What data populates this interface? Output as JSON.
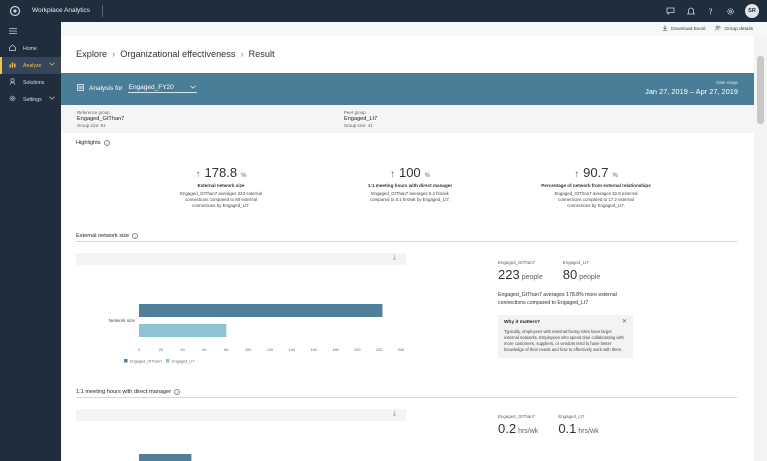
{
  "app": {
    "title": "Workplace Analytics",
    "avatar_initials": "SR",
    "top_icons": [
      "feedback-icon",
      "notifications-icon",
      "help-icon",
      "settings-icon"
    ]
  },
  "nav": {
    "items": [
      {
        "label": "Home",
        "icon": "home-icon"
      },
      {
        "label": "Analyze",
        "icon": "analyze-icon",
        "active": true
      },
      {
        "label": "Solutions",
        "icon": "solutions-icon"
      },
      {
        "label": "Settings",
        "icon": "settings-icon"
      }
    ]
  },
  "commands": {
    "download": "Download Excel",
    "group_details": "Group details"
  },
  "breadcrumb": [
    "Explore",
    "Organizational effectiveness",
    "Result"
  ],
  "analysis": {
    "label": "Analysis for",
    "selected": "Engaged_FY20",
    "date_range_label": "Date range",
    "date_range": "Jan 27, 2019 – Apr 27, 2019"
  },
  "reference_group": {
    "label": "Reference group",
    "name": "Engaged_GtThan7",
    "size": "Group size: 51"
  },
  "peer_group": {
    "label": "Peer group",
    "name": "Engaged_Lt7",
    "size": "Group size: 41"
  },
  "highlights": {
    "title": "Highlights",
    "cards": [
      {
        "value": "178.8",
        "unit": "%",
        "metric": "External network size",
        "desc": "Engaged_GtThan7 averages 223 external connections compared to 80 external connections by Engaged_Lt7."
      },
      {
        "value": "100",
        "unit": "%",
        "metric": "1:1 meeting hours with direct manager",
        "desc": "Engaged_GtThan7 averages 0.2 hrs/wk compared to 0.1 hrs/wk by Engaged_Lt7."
      },
      {
        "value": "90.7",
        "unit": "%",
        "metric": "Percentage of network from external relationships",
        "desc": "Engaged_GtThan7 averages 32.8 external connections compared to 17.2 external connections by Engaged_Lt7."
      }
    ]
  },
  "sections": {
    "external": {
      "title": "External network size",
      "ref_label": "Engaged_GtThan7",
      "ref_value": "223",
      "ref_unit": "people",
      "peer_label": "Engaged_Lt7",
      "peer_value": "80",
      "peer_unit": "people",
      "statement": "Engaged_GtThan7 averages 178.8% more external connections compared to Engaged_Lt7",
      "why_title": "Why it matters?",
      "why_body": "Typically, employees with external-facing roles have larger external networks. Employees who spend time collaborating with more customers, suppliers, or vendors tend to have better knowledge of their needs and how to effectively work with them."
    },
    "meeting": {
      "title": "1:1 meeting hours with direct manager",
      "ref_label": "Engaged_GtThan7",
      "ref_value": "0.2",
      "ref_unit": "hrs/wk",
      "peer_label": "Engaged_Lt7",
      "peer_value": "0.1",
      "peer_unit": "hrs/wk"
    }
  },
  "colors": {
    "nav_bg": "#1f2d3d",
    "band_bg": "#4a7d97",
    "series_ref": "#4f7f99",
    "series_peer": "#8ec3d6",
    "nav_active": "#f3c34b"
  },
  "chart_data": [
    {
      "type": "bar",
      "orientation": "horizontal",
      "categories": [
        "Network size"
      ],
      "series": [
        {
          "name": "Engaged_GtThan7",
          "values": [
            223
          ],
          "color": "#4f7f99"
        },
        {
          "name": "Engaged_Lt7",
          "values": [
            80
          ],
          "color": "#8ec3d6"
        }
      ],
      "x_ticks": [
        "0",
        "20",
        "40",
        "60",
        "80",
        "100",
        "120",
        "140",
        "160",
        "180",
        "200",
        "220",
        "240"
      ],
      "xlim": [
        0,
        240
      ],
      "grid": false,
      "legend": "bottom-left"
    },
    {
      "type": "bar",
      "orientation": "horizontal",
      "categories": [
        ""
      ],
      "series": [
        {
          "name": "Engaged_GtThan7",
          "values": [
            0.2
          ],
          "color": "#4f7f99"
        }
      ],
      "legend": "none"
    }
  ]
}
